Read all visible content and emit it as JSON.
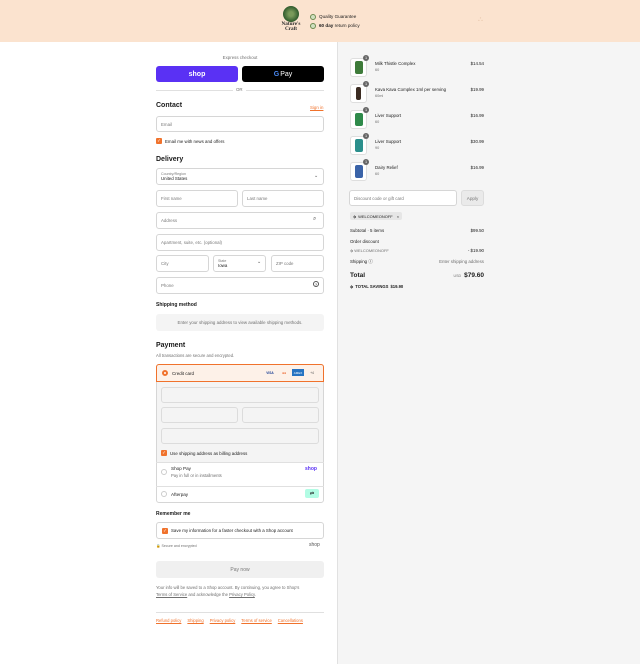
{
  "header": {
    "brand_line1": "Nature's",
    "brand_line2": "Craft",
    "guarantee": "Quality Guarantee",
    "return_bold": "60 day",
    "return_rest": " return policy",
    "cart_icon": "bag-icon"
  },
  "express": {
    "label": "Express checkout",
    "shop": "shop",
    "gpay_g": "G",
    "gpay_pay": " Pay",
    "or": "OR"
  },
  "contact": {
    "title": "Contact",
    "sign_in": "Sign in",
    "email_placeholder": "Email",
    "news": "Email me with news and offers"
  },
  "delivery": {
    "title": "Delivery",
    "country_label": "Country/Region",
    "country": "United States",
    "first": "First name",
    "last": "Last name",
    "address": "Address",
    "apartment": "Apartment, suite, etc. (optional)",
    "city": "City",
    "state_label": "State",
    "state": "Iowa",
    "zip": "ZIP code",
    "phone": "Phone"
  },
  "shipping": {
    "title": "Shipping method",
    "note": "Enter your shipping address to view available shipping methods."
  },
  "payment": {
    "title": "Payment",
    "subtitle": "All transactions are secure and encrypted.",
    "credit": "Credit card",
    "cards": [
      "VISA",
      "●●",
      "AMEX",
      "+4"
    ],
    "billing": "Use shipping address as billing address",
    "shoppay": "Shop Pay",
    "shoppay_sub": "Pay in full or in installments",
    "shoppay_logo": "shop",
    "afterpay": "Afterpay"
  },
  "remember": {
    "title": "Remember me",
    "save": "Save my information for a faster checkout with a Shop account",
    "secure": "Secure and encrypted",
    "shop_logo": "shop"
  },
  "pay_now": "Pay now",
  "terms": {
    "line1": "Your info will be saved to a Shop account. By continuing, you agree to Shop's",
    "tos": "Terms of Service",
    "mid": " and acknowledge the ",
    "privacy": "Privacy Policy",
    "end": "."
  },
  "footer_links": [
    "Refund policy",
    "Shipping",
    "Privacy policy",
    "Terms of service",
    "Cancellations"
  ],
  "items": [
    {
      "name": "Milk Thistle Complex",
      "variant": "60",
      "price": "$14.54",
      "qty": "1",
      "color": "#3e7b3a"
    },
    {
      "name": "Kava Kava Complex 1ml per serving",
      "variant": "60ml",
      "price": "$19.99",
      "qty": "1",
      "color": "#3b2b22"
    },
    {
      "name": "Liver Support",
      "variant": "60",
      "price": "$16.99",
      "qty": "1",
      "color": "#2e8a4a"
    },
    {
      "name": "Liver Support",
      "variant": "90",
      "price": "$30.99",
      "qty": "1",
      "color": "#2b8f8c"
    },
    {
      "name": "Dairy Relief",
      "variant": "60",
      "price": "$16.99",
      "qty": "1",
      "color": "#3a63a8"
    }
  ],
  "discount": {
    "placeholder": "Discount code or gift card",
    "apply": "Apply",
    "code": "WELCOMEONOFF"
  },
  "summary": {
    "subtotal_label": "Subtotal · 5 items",
    "subtotal": "$99.50",
    "order_discount": "Order discount",
    "code": "WELCOMEONOFF",
    "discount": "- $19.90",
    "shipping_label": "Shipping",
    "shipping": "Enter shipping address",
    "total_label": "Total",
    "currency": "USD",
    "total": "$79.60",
    "savings": "TOTAL SAVINGS",
    "savings_amt": "$19.90"
  }
}
